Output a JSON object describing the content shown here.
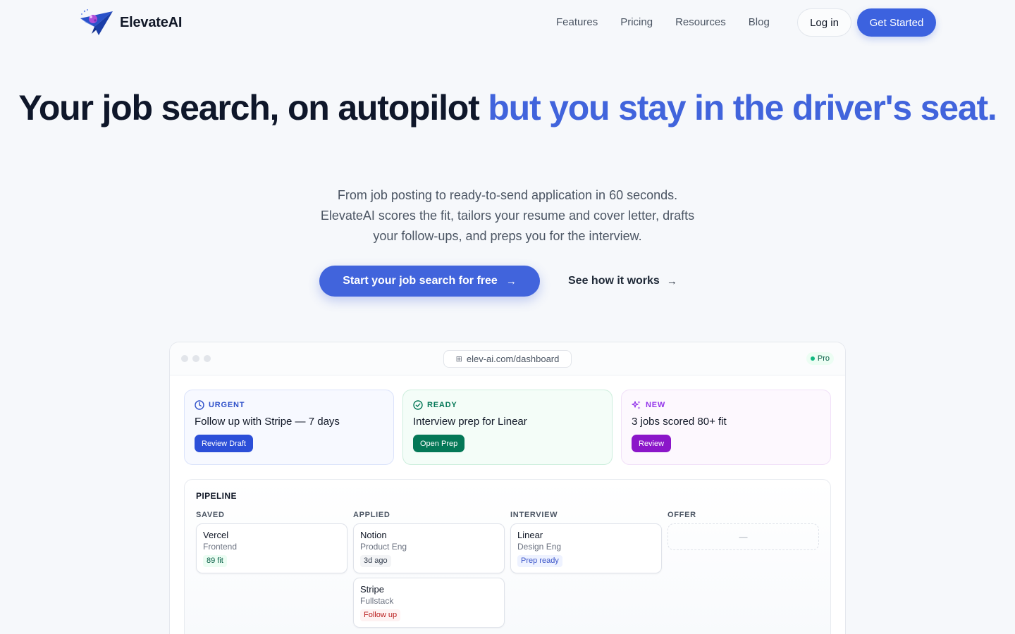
{
  "nav": {
    "brand": "ElevateAI",
    "links": [
      "Features",
      "Pricing",
      "Resources",
      "Blog"
    ],
    "login_label": "Log in",
    "get_started_label": "Get Started"
  },
  "hero": {
    "title_main": "Your job search, on autopilot ",
    "title_accent": "but you stay in the driver's seat.",
    "subtitle_lines": [
      "From job posting to ready-to-send application in 60 seconds.",
      "ElevateAI scores the fit, tailors your resume and cover letter, drafts",
      "your follow-ups, and preps you for the interview."
    ],
    "cta_primary": "Start your job search for free",
    "cta_secondary": "See how it works"
  },
  "dashboard": {
    "url": "elev-ai.com/dashboard",
    "plan_badge": "Pro",
    "cards": [
      {
        "label": "URGENT",
        "title": "Follow up with Stripe — 7 days",
        "button": "Review Draft",
        "icon": "clock-icon"
      },
      {
        "label": "READY",
        "title": "Interview prep for Linear",
        "button": "Open Prep",
        "icon": "check-circle-icon"
      },
      {
        "label": "NEW",
        "title": "3 jobs scored 80+ fit",
        "button": "Review",
        "icon": "sparkles-icon"
      }
    ],
    "pipeline": {
      "title": "PIPELINE",
      "columns": [
        {
          "name": "SAVED",
          "jobs": [
            {
              "company": "Vercel",
              "role": "Frontend",
              "tag": "89 fit"
            }
          ]
        },
        {
          "name": "APPLIED",
          "jobs": [
            {
              "company": "Notion",
              "role": "Product Eng",
              "tag": "3d ago"
            },
            {
              "company": "Stripe",
              "role": "Fullstack",
              "tag": "Follow up"
            }
          ]
        },
        {
          "name": "INTERVIEW",
          "jobs": [
            {
              "company": "Linear",
              "role": "Design Eng",
              "tag": "Prep ready"
            }
          ]
        },
        {
          "name": "OFFER",
          "empty": "—"
        }
      ]
    }
  },
  "colors": {
    "brand_blue": "#4164dc",
    "urgent": "#2c4fd8",
    "ready": "#047857",
    "new": "#8b16c9"
  }
}
